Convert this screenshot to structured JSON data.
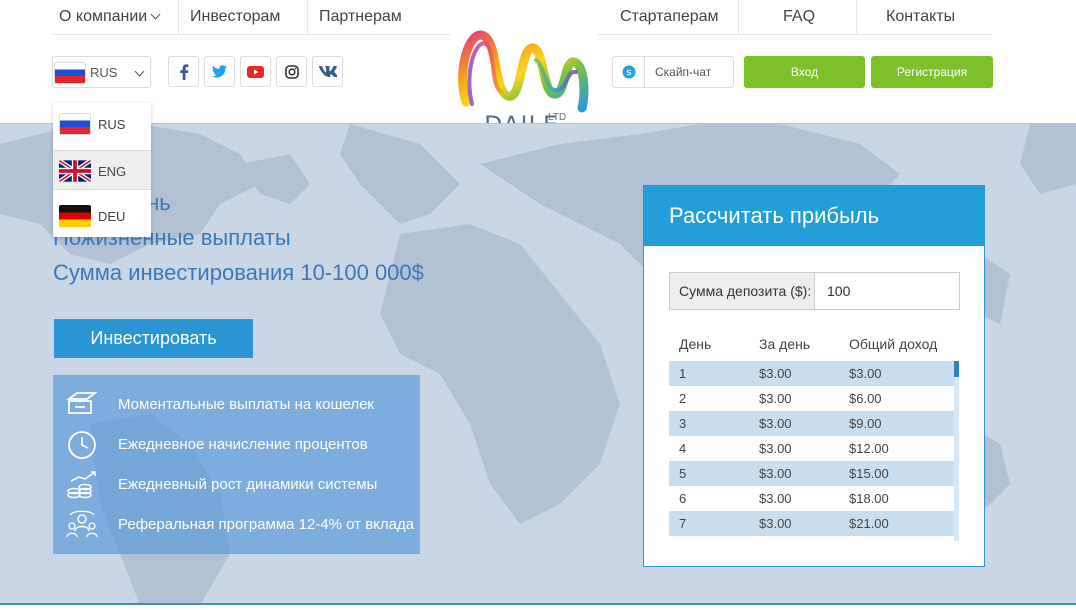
{
  "topnav": {
    "about": "О компании",
    "investors": "Инвесторам",
    "partners": "Партнерам",
    "startups": "Стартаперам",
    "faq": "FAQ",
    "contacts": "Контакты"
  },
  "language": {
    "selected": "RUS",
    "options": [
      "RUS",
      "ENG",
      "DEU"
    ],
    "highlighted": "ENG"
  },
  "social": [
    "facebook-icon",
    "twitter-icon",
    "youtube-icon",
    "instagram-icon",
    "vk-icon"
  ],
  "skype_placeholder": "Скайп-чат",
  "login_label": "Вход",
  "register_label": "Регистрация",
  "logo": {
    "name": "DAILE",
    "suffix": "LTD"
  },
  "hero": {
    "line1": "…дый день",
    "line2": "Пожизненные выплаты",
    "line3": "Сумма инвестирования 10-100 000$",
    "invest_button": "Инвестировать"
  },
  "features": [
    {
      "icon": "wallet-transfer-icon",
      "text": "Моментальные выплаты на кошелек"
    },
    {
      "icon": "clock-icon",
      "text": "Ежедневное начисление процентов"
    },
    {
      "icon": "coins-growth-icon",
      "text": "Ежедневный рост динамики системы"
    },
    {
      "icon": "referral-people-icon",
      "text": "Реферальная программа 12-4% от вклада"
    }
  ],
  "calculator": {
    "title": "Рассчитать прибыль",
    "deposit_label": "Сумма депозита ($):",
    "deposit_value": "100",
    "headers": [
      "День",
      "За день",
      "Общий доход"
    ],
    "rows": [
      [
        "1",
        "$3.00",
        "$3.00"
      ],
      [
        "2",
        "$3.00",
        "$6.00"
      ],
      [
        "3",
        "$3.00",
        "$9.00"
      ],
      [
        "4",
        "$3.00",
        "$12.00"
      ],
      [
        "5",
        "$3.00",
        "$15.00"
      ],
      [
        "6",
        "$3.00",
        "$18.00"
      ],
      [
        "7",
        "$3.00",
        "$21.00"
      ]
    ]
  },
  "colors": {
    "accent_blue": "#229ed9",
    "green": "#7cc12a",
    "hero_text": "#3a79b8",
    "map_bg": "#c8d6e6"
  }
}
